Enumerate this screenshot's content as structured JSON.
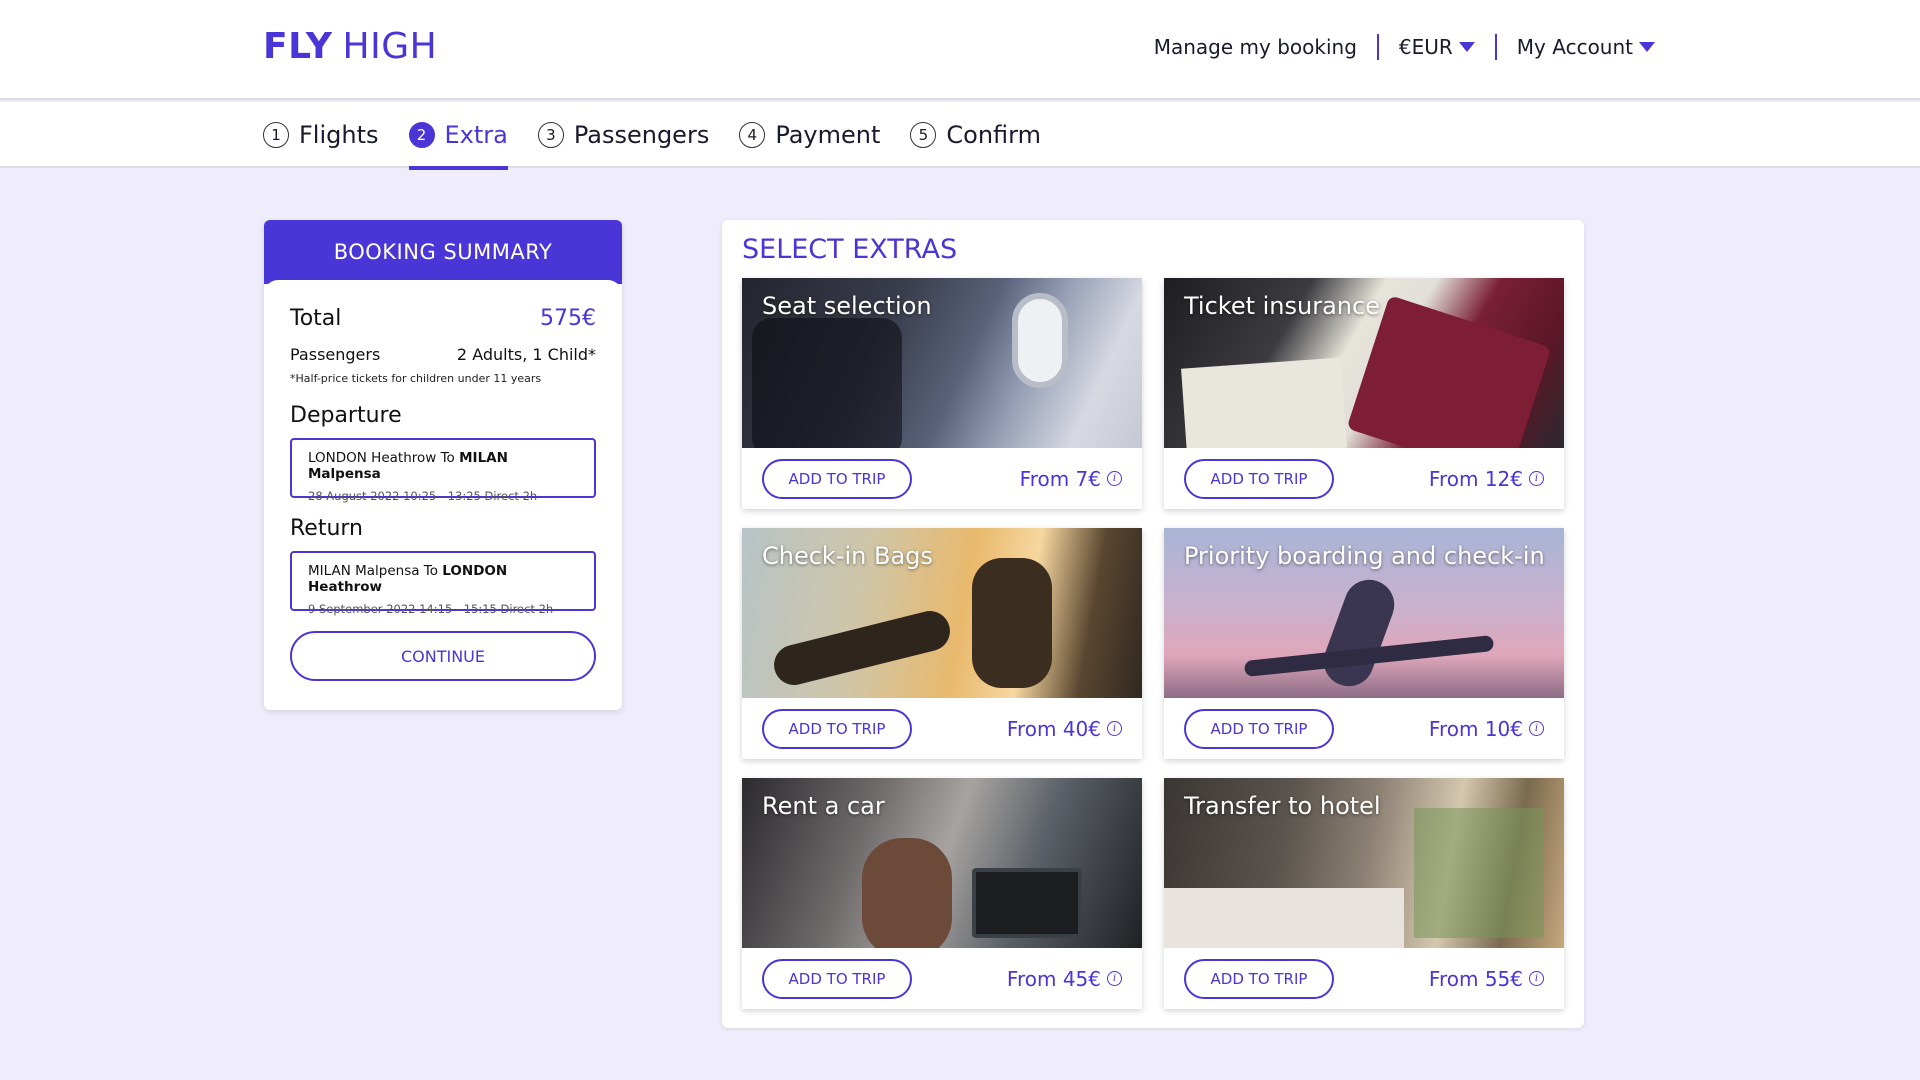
{
  "brand": {
    "fly": "FLY",
    "high": "HIGH",
    "color": "#4a35d6"
  },
  "topnav": {
    "manage": "Manage my booking",
    "currency": "€EUR",
    "account": "My Account"
  },
  "steps": [
    {
      "num": "1",
      "label": "Flights"
    },
    {
      "num": "2",
      "label": "Extra"
    },
    {
      "num": "3",
      "label": "Passengers"
    },
    {
      "num": "4",
      "label": "Payment"
    },
    {
      "num": "5",
      "label": "Confirm"
    }
  ],
  "active_step": "Extra",
  "summary": {
    "title": "BOOKING SUMMARY",
    "total_label": "Total",
    "total_value": "575€",
    "passengers_label": "Passengers",
    "passengers_value": "2 Adults, 1 Child*",
    "note": "*Half-price tickets for children under 11 years",
    "departure_title": "Departure",
    "departure": {
      "from": "LONDON Heathrow To ",
      "to": "MILAN Malpensa",
      "meta": "28 August 2022  10:25 - 13:25  Direct 2h"
    },
    "return_title": "Return",
    "return": {
      "from": "MILAN Malpensa To ",
      "to": "LONDON Heathrow",
      "meta": "9 September 2022   14:15 - 15:15   Direct 2h"
    },
    "continue": "CONTINUE"
  },
  "extras": {
    "title": "SELECT EXTRAS",
    "add_label": "ADD TO TRIP",
    "items": [
      {
        "title": "Seat selection",
        "price": "From 7€"
      },
      {
        "title": "Ticket insurance",
        "price": "From 12€"
      },
      {
        "title": "Check-in Bags",
        "price": "From 40€"
      },
      {
        "title": "Priority boarding and check-in",
        "price": "From 10€"
      },
      {
        "title": "Rent a car",
        "price": "From 45€"
      },
      {
        "title": "Transfer to hotel",
        "price": "From 55€"
      }
    ]
  },
  "icons": {
    "currency_caret": "chevron-down-icon",
    "account_caret": "chevron-down-icon",
    "price_info": "info-icon"
  }
}
